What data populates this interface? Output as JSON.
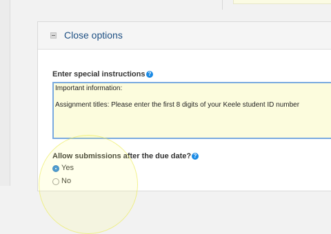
{
  "section": {
    "title": "Close options"
  },
  "instructions": {
    "label": "Enter special instructions",
    "help": "?",
    "value": "Important information:\n\nAssignment titles: Please enter the first 8 digits of your Keele student ID number"
  },
  "late_submissions": {
    "label": "Allow submissions after the due date?",
    "help": "?",
    "options": [
      {
        "label": "Yes",
        "checked": true
      },
      {
        "label": "No",
        "checked": false
      }
    ]
  },
  "colors": {
    "title_link": "#1d4f83",
    "help_icon": "#1a8ae5",
    "textarea_bg": "#fcfcdd",
    "textarea_border": "#79a9df",
    "radio_checked": "#2f8ae0"
  },
  "icons": {
    "collapse": "minus-square-icon",
    "help": "question-circle-icon",
    "radio_selected": "radio-selected-icon",
    "radio_unselected": "radio-unselected-icon"
  }
}
